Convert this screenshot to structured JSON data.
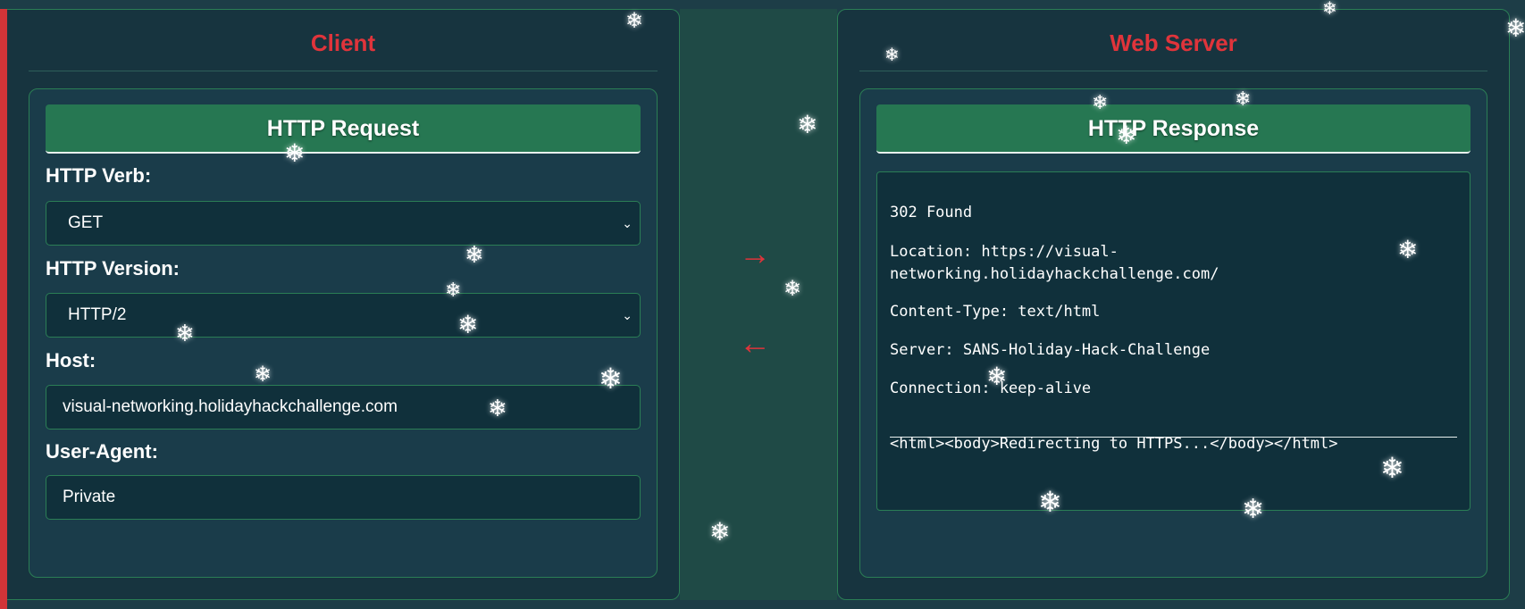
{
  "client": {
    "title": "Client",
    "request": {
      "header": "HTTP Request",
      "verb_label": "HTTP Verb:",
      "verb_value": "GET",
      "version_label": "HTTP Version:",
      "version_value": "HTTP/2",
      "host_label": "Host:",
      "host_value": "visual-networking.holidayhackchallenge.com",
      "ua_label": "User-Agent:",
      "ua_value": "Private"
    }
  },
  "server": {
    "title": "Web Server",
    "response": {
      "header": "HTTP Response",
      "status": "302 Found",
      "location_1": "Location: https://visual-",
      "location_2": "networking.holidayhackchallenge.com/",
      "content_type": "Content-Type: text/html",
      "server_line": "Server: SANS-Holiday-Hack-Challenge",
      "connection": "Connection: keep-alive",
      "body": "<html><body>Redirecting to HTTPS...</body></html>"
    }
  },
  "arrows": {
    "to_server": "→",
    "to_client": "←"
  },
  "decor": {
    "flake_glyph": "❄",
    "accent_color": "#e0343b",
    "header_color": "#267752"
  }
}
